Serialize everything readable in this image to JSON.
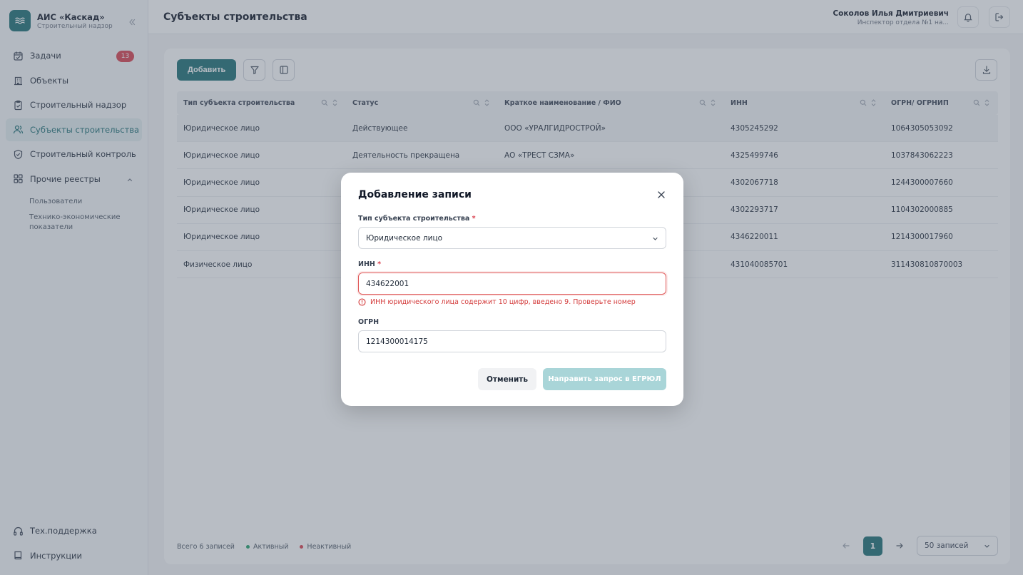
{
  "brand": {
    "title": "АИС «Каскад»",
    "subtitle": "Строительный надзор",
    "logo_icon": "waves-icon"
  },
  "sidebar": {
    "items": [
      {
        "label": "Задачи",
        "icon": "calendar-icon",
        "badge": "13"
      },
      {
        "label": "Объекты",
        "icon": "building-icon"
      },
      {
        "label": "Строительный надзор",
        "icon": "clipboard-icon"
      },
      {
        "label": "Субъекты строительства",
        "icon": "users-icon",
        "active": true
      },
      {
        "label": "Строительный контроль",
        "icon": "shield-check-icon"
      },
      {
        "label": "Прочие реестры",
        "icon": "grid-icon"
      }
    ],
    "sub_items": [
      "Пользователи",
      "Технико-экономические показатели"
    ],
    "bottom": [
      {
        "label": "Тех.поддержка",
        "icon": "headphones-icon"
      },
      {
        "label": "Инструкции",
        "icon": "book-icon"
      }
    ]
  },
  "header": {
    "title": "Субъекты строительства",
    "user_name": "Соколов Илья Дмитриевич",
    "user_role": "Инспектор отдела №1 на..."
  },
  "toolbar": {
    "add_label": "Добавить"
  },
  "table": {
    "columns": [
      "Тип субъекта строительства",
      "Статус",
      "Краткое наименование / ФИО",
      "ИНН",
      "ОГРН/ ОГРНИП"
    ],
    "rows": [
      [
        "Юридическое лицо",
        "Действующее",
        "ООО «УРАЛГИДРОСТРОЙ»",
        "4305245292",
        "1064305053092"
      ],
      [
        "Юридическое лицо",
        "Деятельность прекращена",
        "АО «ТРЕСТ СЗМА»",
        "4325499746",
        "1037843062223"
      ],
      [
        "Юридическое лицо",
        "",
        "",
        "4302067718",
        "1244300007660"
      ],
      [
        "Юридическое лицо",
        "",
        "",
        "4302293717",
        "1104302000885"
      ],
      [
        "Юридическое лицо",
        "",
        "",
        "4346220011",
        "1214300017960"
      ],
      [
        "Физическое лицо",
        "",
        "",
        "431040085701",
        "311430810870003"
      ]
    ]
  },
  "footer": {
    "total": "Всего 6 записей",
    "legend_active": "Активный",
    "legend_inactive": "Неактивный",
    "active_color": "#22a06b",
    "inactive_color": "#d9414e",
    "page": "1",
    "per_page": "50 записей"
  },
  "modal": {
    "title": "Добавление записи",
    "type_label": "Тип субъекта строительства",
    "type_value": "Юридическое лицо",
    "inn_label": "ИНН",
    "inn_value": "434622001",
    "inn_error": "ИНН юридического лица содержит 10 цифр, введено 9. Проверьте номер",
    "ogrn_label": "ОГРН",
    "ogrn_value": "1214300014175",
    "cancel_label": "Отменить",
    "submit_label": "Направить запрос в ЕГРЮЛ"
  },
  "colors": {
    "accent": "#1d6f74",
    "error": "#d43c3c"
  }
}
